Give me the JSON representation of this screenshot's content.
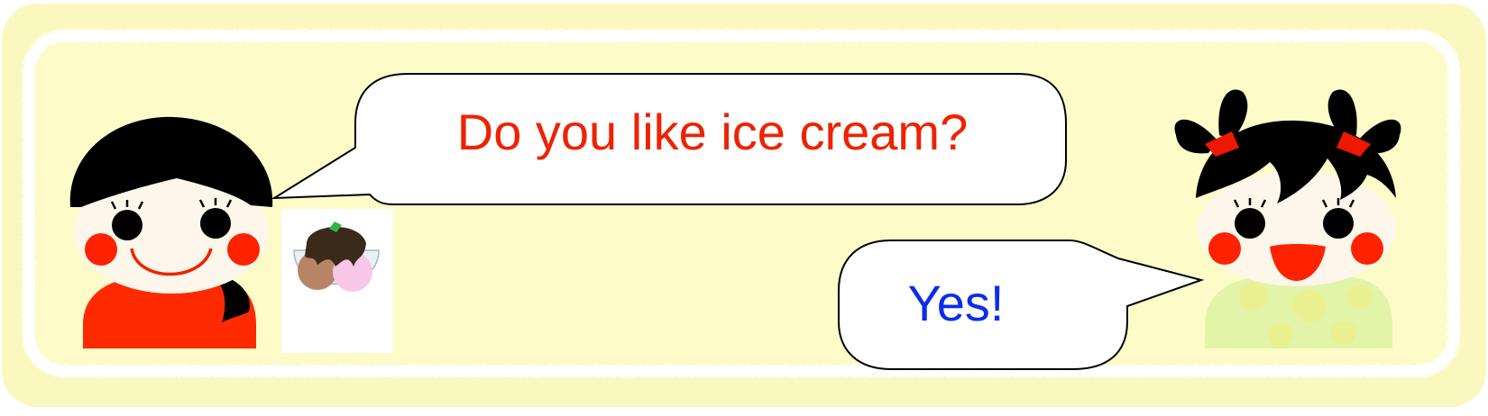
{
  "dialogue": {
    "question": "Do you like ice cream?",
    "answer": "Yes!"
  },
  "colors": {
    "question_text": "#ee2200",
    "answer_text": "#0a2ee8",
    "panel_background": "#fdfcc8",
    "panel_frame": "#f8f6b8",
    "cheek": "#ff2200",
    "boy_shirt": "#ff2a00",
    "girl_dress": "#e2f4a8",
    "hair": "#000000",
    "hair_ribbon": "#ee1800",
    "skin": "#fdf6ea"
  },
  "characters": {
    "left": "boy-character",
    "right": "girl-character"
  },
  "prop": "ice-cream-bowl-icon"
}
